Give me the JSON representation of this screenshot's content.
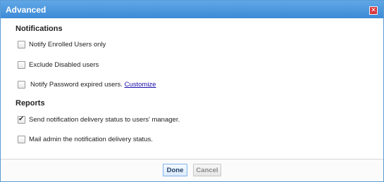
{
  "dialog": {
    "title": "Advanced",
    "close_symbol": "✕"
  },
  "notifications": {
    "heading": "Notifications",
    "options": [
      {
        "label": "Notify Enrolled Users only",
        "checked": false
      },
      {
        "label": "Exclude Disabled users",
        "checked": false
      },
      {
        "label": "Notify Password expired users.",
        "link": "Customize",
        "checked": false
      }
    ]
  },
  "reports": {
    "heading": "Reports",
    "options": [
      {
        "label": "Send notification delivery status to users' manager.",
        "checked": true
      },
      {
        "label": "Mail admin the notification delivery status.",
        "checked": false
      }
    ]
  },
  "footer": {
    "done_label": "Done",
    "cancel_label": "Cancel"
  },
  "colors": {
    "titlebar": "#3d8ad6",
    "close": "#d9363e",
    "link": "#1a0dab"
  }
}
